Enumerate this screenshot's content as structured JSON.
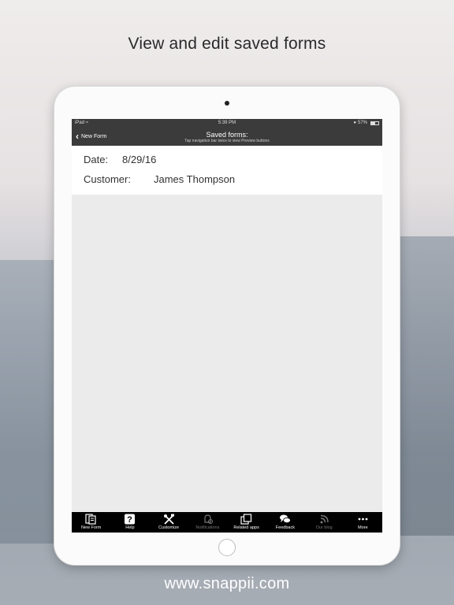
{
  "headline": "View and edit saved forms",
  "footer_url": "www.snappii.com",
  "status_bar": {
    "device": "iPad",
    "time": "5:39 PM",
    "battery": "57%",
    "battery_level": 0.57
  },
  "nav": {
    "back_label": "New Form",
    "title": "Saved forms:",
    "subtitle": "Tap navigation bar twice to view Preview buttons"
  },
  "form": {
    "date_label": "Date:",
    "date_value": "8/29/16",
    "customer_label": "Customer:",
    "customer_value": "James Thompson"
  },
  "tabs": [
    {
      "label": "New Form",
      "icon": "new-form-icon"
    },
    {
      "label": "Help",
      "icon": "help-icon"
    },
    {
      "label": "Customize",
      "icon": "customize-tools-icon"
    },
    {
      "label": "Notifications",
      "icon": "notifications-icon"
    },
    {
      "label": "Related apps",
      "icon": "related-apps-icon"
    },
    {
      "label": "Feedback",
      "icon": "feedback-chat-icon"
    },
    {
      "label": "Our blog",
      "icon": "rss-icon"
    },
    {
      "label": "More",
      "icon": "more-dots-icon"
    }
  ]
}
